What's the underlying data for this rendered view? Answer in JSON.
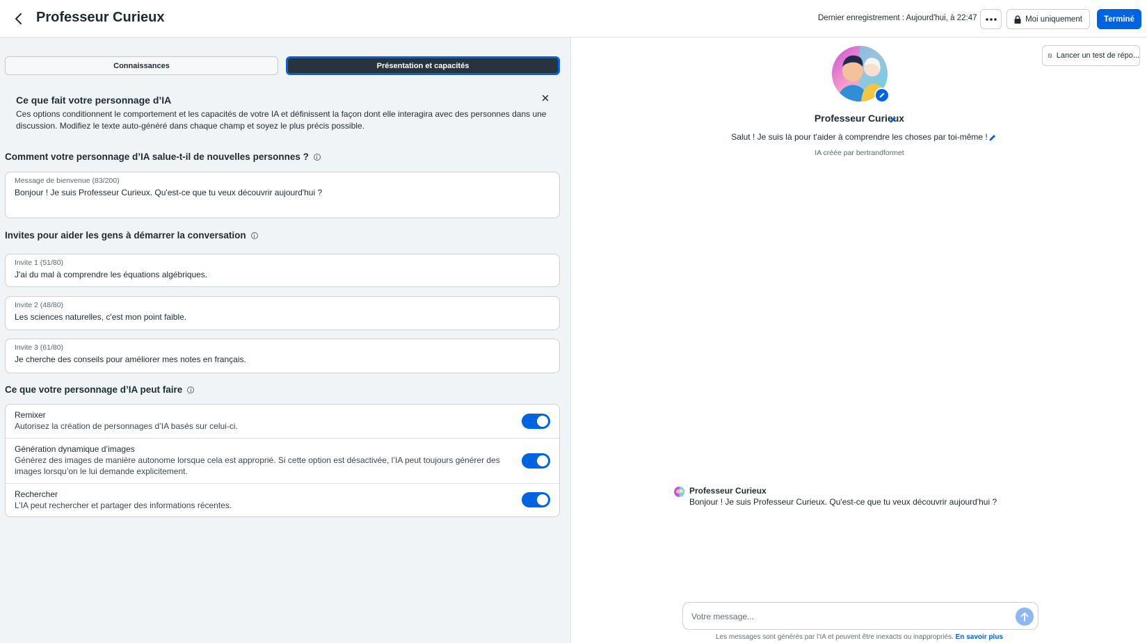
{
  "header": {
    "title": "Professeur Curieux",
    "last_saved": "Dernier enregistrement : Aujourd'hui, à 22:47",
    "privacy_label": "Moi uniquement",
    "done_label": "Terminé"
  },
  "tabs": [
    {
      "label": "Connaissances",
      "active": false
    },
    {
      "label": "Présentation et capacités",
      "active": true
    }
  ],
  "info": {
    "title": "Ce que fait votre personnage d’IA",
    "text": "Ces options conditionnent le comportement et les capacités de votre IA et définissent la façon dont elle interagira avec des personnes dans une discussion. Modifiez le texte auto-généré dans chaque champ et soyez le plus précis possible."
  },
  "greeting": {
    "section_title": "Comment votre personnage d’IA salue-t-il de nouvelles personnes ?",
    "label": "Message de bienvenue (83/200)",
    "value": "Bonjour ! Je suis Professeur Curieux. Qu'est-ce que tu veux découvrir aujourd'hui ?"
  },
  "prompts": {
    "section_title": "Invites pour aider les gens à démarrer la conversation",
    "items": [
      {
        "label": "Invite 1 (51/80)",
        "value": "J'ai du mal à comprendre les équations algébriques."
      },
      {
        "label": "Invite 2 (48/80)",
        "value": "Les sciences naturelles, c'est mon point faible."
      },
      {
        "label": "Invite 3 (61/80)",
        "value": "Je cherche des conseils pour améliorer mes notes en français."
      }
    ]
  },
  "capabilities": {
    "section_title": "Ce que votre personnage d’IA peut faire",
    "items": [
      {
        "title": "Remixer",
        "desc": "Autorisez la création de personnages d’IA basés sur celui-ci.",
        "enabled": true
      },
      {
        "title": "Génération dynamique d’images",
        "desc": "Générez des images de manière autonome lorsque cela est approprié. Si cette option est désactivée, l’IA peut toujours générer des images lorsqu’on le lui demande explicitement.",
        "enabled": true
      },
      {
        "title": "Rechercher",
        "desc": "L’IA peut rechercher et partager des informations récentes.",
        "enabled": true
      }
    ]
  },
  "preview": {
    "test_button": "Lancer un test de répo...",
    "ai_name": "Professeur Curieux",
    "tagline": "Salut ! Je suis là pour t'aider à comprendre les choses par toi-même !",
    "creator": "IA créée par bertrandformet",
    "message_sender": "Professeur Curieux",
    "message_text": "Bonjour ! Je suis Professeur Curieux. Qu'est-ce que tu veux découvrir aujourd'hui ?",
    "composer_placeholder": "Votre message...",
    "disclaimer": "Les messages sont générés par l’IA et peuvent être inexacts ou inappropriés.",
    "learn_more": "En savoir plus"
  },
  "colors": {
    "accent": "#0064e0",
    "active_tab": "#27343e",
    "panel_bg": "#f1f4f7"
  }
}
